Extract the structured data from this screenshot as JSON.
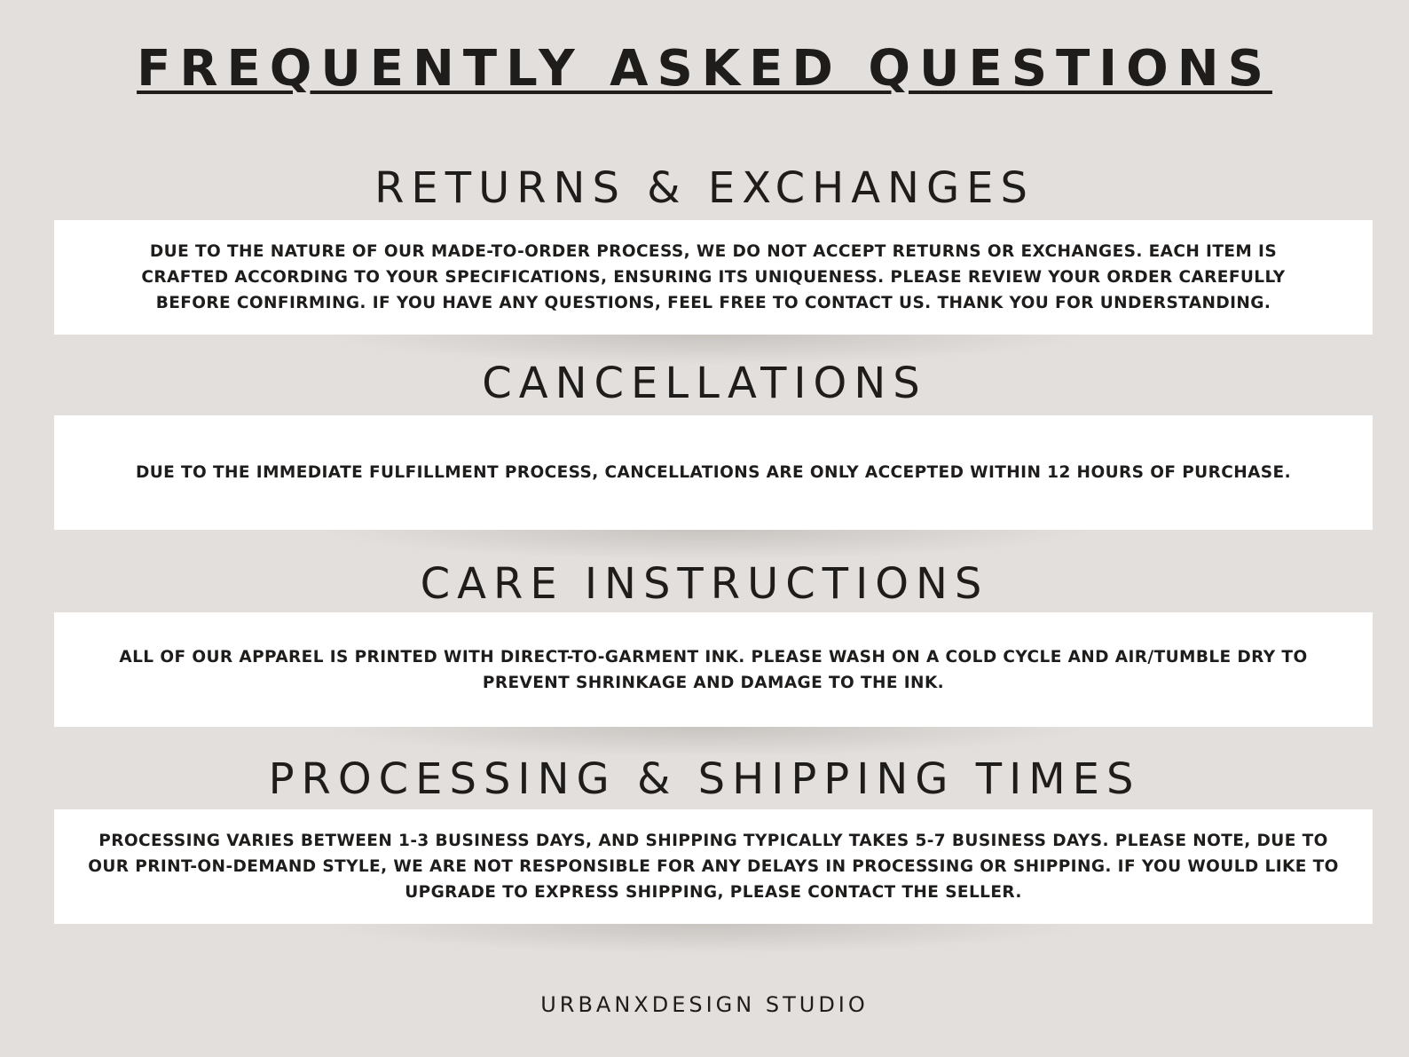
{
  "title": "FREQUENTLY ASKED QUESTIONS",
  "sections": [
    {
      "heading": "RETURNS & EXCHANGES",
      "text": "DUE TO THE NATURE OF OUR MADE-TO-ORDER PROCESS, WE DO NOT ACCEPT RETURNS OR EXCHANGES. EACH ITEM IS CRAFTED ACCORDING TO YOUR SPECIFICATIONS, ENSURING ITS UNIQUENESS. PLEASE REVIEW YOUR ORDER CAREFULLY BEFORE CONFIRMING. IF YOU HAVE ANY QUESTIONS, FEEL FREE TO CONTACT US. THANK YOU FOR UNDERSTANDING."
    },
    {
      "heading": "CANCELLATIONS",
      "text": "DUE TO THE IMMEDIATE FULFILLMENT PROCESS, CANCELLATIONS ARE ONLY ACCEPTED WITHIN 12 HOURS OF PURCHASE."
    },
    {
      "heading": "CARE INSTRUCTIONS",
      "text": "ALL OF OUR APPAREL IS PRINTED WITH DIRECT-TO-GARMENT INK. PLEASE WASH ON A COLD CYCLE AND AIR/TUMBLE DRY TO PREVENT SHRINKAGE AND DAMAGE TO THE INK."
    },
    {
      "heading": "PROCESSING & SHIPPING TIMES",
      "text": "PROCESSING VARIES BETWEEN 1-3 BUSINESS DAYS, AND SHIPPING TYPICALLY TAKES 5-7 BUSINESS DAYS. PLEASE NOTE, DUE TO OUR PRINT-ON-DEMAND STYLE, WE ARE NOT RESPONSIBLE FOR ANY DELAYS IN PROCESSING OR SHIPPING. IF YOU WOULD LIKE TO UPGRADE TO EXPRESS SHIPPING, PLEASE CONTACT THE SELLER."
    }
  ],
  "footer": "URBANXDESIGN STUDIO",
  "colors": {
    "background": "#e3dfdc",
    "panel": "#ffffff",
    "text": "#1f1d1c"
  }
}
